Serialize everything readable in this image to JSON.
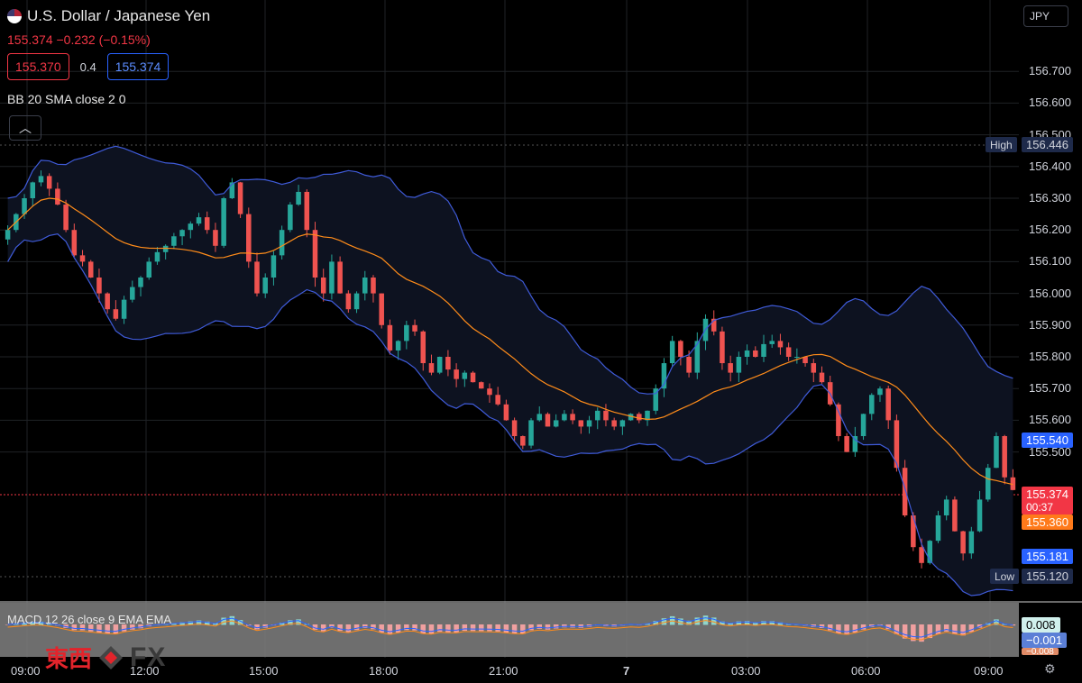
{
  "header": {
    "title": "U.S. Dollar / Japanese Yen",
    "last": "155.374",
    "change": "−0.232 (−0.15%)",
    "bid": "155.370",
    "spread": "0.4",
    "ask": "155.374"
  },
  "indicators": {
    "bb_label": "BB 20 SMA close 2 0",
    "macd_label": "MACD 12 26 close 9 EMA EMA",
    "collapse_icon": "chevron-up-icon"
  },
  "currency_button": "JPY",
  "price_axis": [
    "156.700",
    "156.600",
    "156.500",
    "156.400",
    "156.300",
    "156.200",
    "156.100",
    "156.000",
    "155.900",
    "155.800",
    "155.700",
    "155.600",
    "155.500"
  ],
  "price_tags": {
    "high_label": "High",
    "high_value": "156.446",
    "upper_band": "155.540",
    "last": "155.374",
    "countdown": "00:37",
    "basis": "155.360",
    "lower_band": "155.181",
    "low_label": "Low",
    "low_value": "155.120"
  },
  "macd_tags": {
    "macd": "0.008",
    "signal": "−0.001",
    "hist": "−0.008"
  },
  "time_axis": [
    "09:00",
    "12:00",
    "15:00",
    "18:00",
    "21:00",
    "7",
    "03:00",
    "06:00",
    "09:00"
  ],
  "logo": {
    "kanji": "東西",
    "fx": "FX"
  },
  "colors": {
    "up": "#26a69a",
    "down": "#ef5350",
    "band": "#3f5bd9",
    "basis": "#ff8c1a",
    "last": "#f23645",
    "bg": "#000000"
  },
  "chart_data": {
    "type": "candlestick",
    "ylim": [
      155.05,
      156.8
    ],
    "close": [
      156.2,
      156.25,
      156.3,
      156.35,
      156.37,
      156.33,
      156.28,
      156.2,
      156.12,
      156.1,
      156.05,
      156.0,
      155.95,
      155.92,
      155.98,
      156.02,
      156.05,
      156.1,
      156.13,
      156.15,
      156.18,
      156.2,
      156.22,
      156.24,
      156.2,
      156.15,
      156.3,
      156.35,
      156.25,
      156.1,
      156.0,
      156.05,
      156.12,
      156.2,
      156.28,
      156.32,
      156.2,
      156.05,
      156.0,
      156.1,
      156.0,
      155.95,
      156.0,
      156.05,
      156.0,
      155.9,
      155.82,
      155.85,
      155.9,
      155.88,
      155.78,
      155.75,
      155.8,
      155.76,
      155.73,
      155.75,
      155.72,
      155.7,
      155.68,
      155.65,
      155.6,
      155.55,
      155.52,
      155.6,
      155.62,
      155.58,
      155.6,
      155.62,
      155.6,
      155.58,
      155.6,
      155.63,
      155.6,
      155.58,
      155.6,
      155.62,
      155.6,
      155.63,
      155.7,
      155.78,
      155.85,
      155.8,
      155.75,
      155.85,
      155.92,
      155.88,
      155.78,
      155.75,
      155.8,
      155.82,
      155.8,
      155.84,
      155.85,
      155.83,
      155.8,
      155.8,
      155.78,
      155.75,
      155.72,
      155.65,
      155.55,
      155.5,
      155.55,
      155.62,
      155.68,
      155.7,
      155.6,
      155.45,
      155.3,
      155.2,
      155.15,
      155.22,
      155.3,
      155.35,
      155.25,
      155.18,
      155.25,
      155.35,
      155.45,
      155.55,
      155.42,
      155.38
    ],
    "upper_band": "155.540",
    "basis": "155.360",
    "lower_band": "155.181"
  }
}
